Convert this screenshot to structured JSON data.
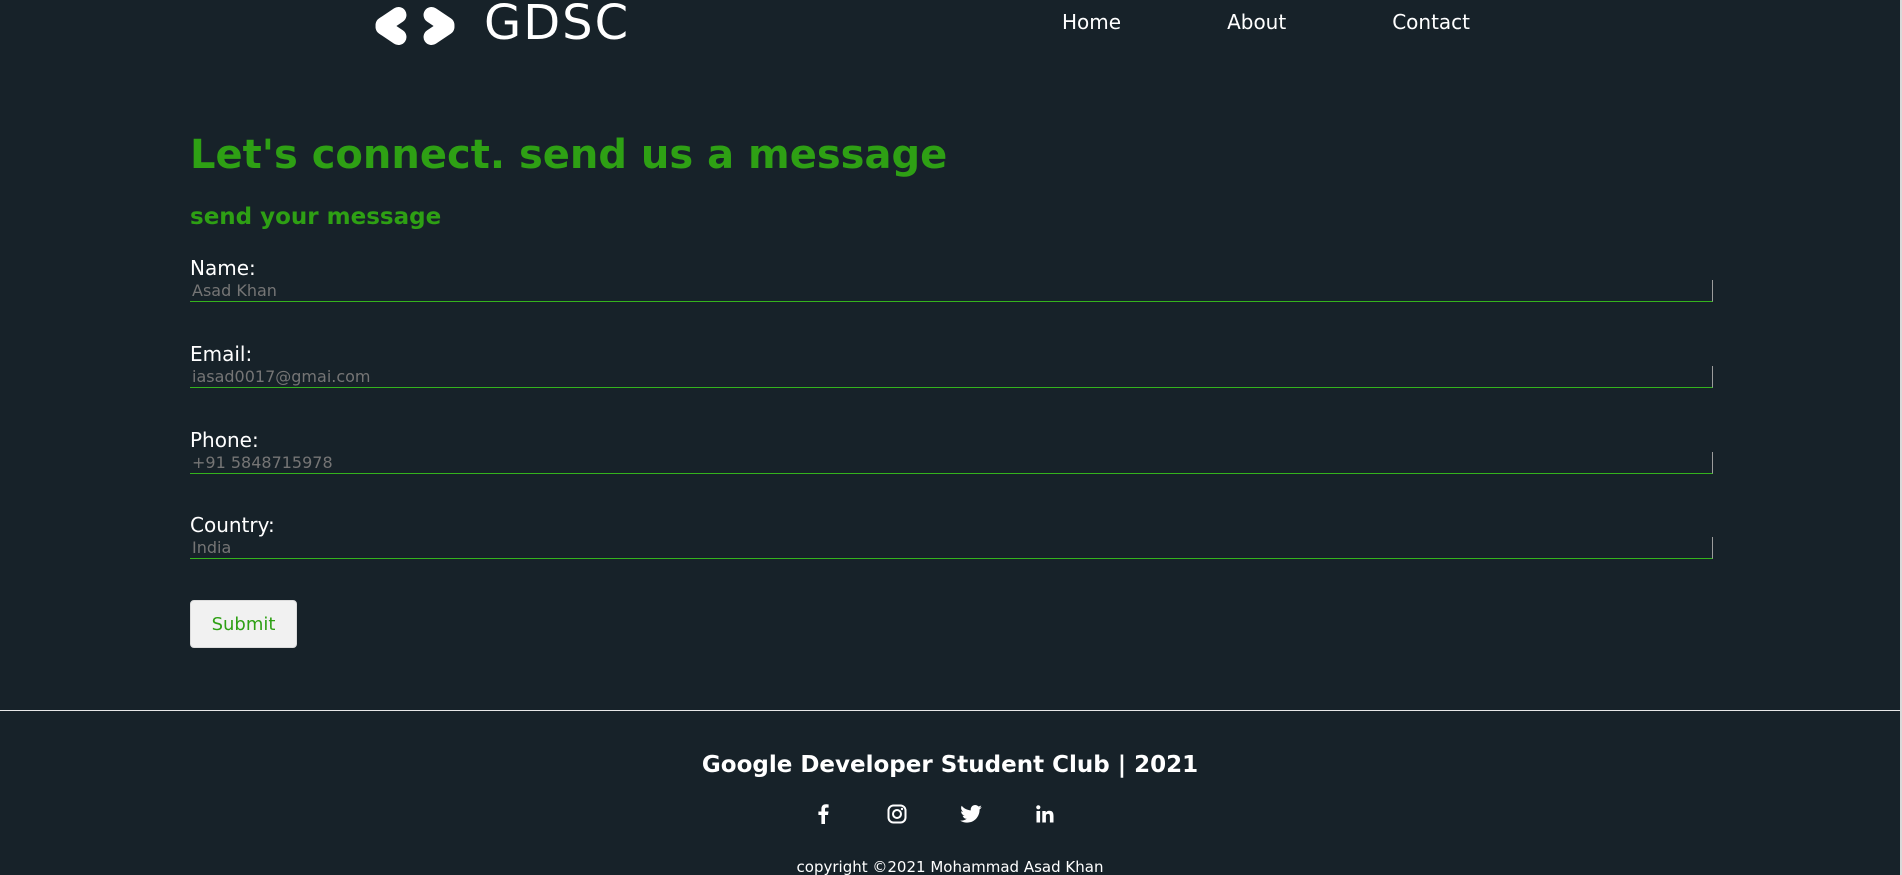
{
  "header": {
    "logo_text": "GDSC",
    "nav": {
      "home": "Home",
      "about": "About",
      "contact": "Contact"
    }
  },
  "contact": {
    "heading": "Let's connect. send us a message",
    "subheading": "send your message",
    "fields": {
      "name": {
        "label": "Name:",
        "placeholder": "Asad Khan"
      },
      "email": {
        "label": "Email:",
        "placeholder": "iasad0017@gmai.com"
      },
      "phone": {
        "label": "Phone:",
        "placeholder": "+91 5848715978"
      },
      "country": {
        "label": "Country:",
        "placeholder": "India"
      }
    },
    "submit_label": "Submit"
  },
  "footer": {
    "title": "Google Developer Student Club | 2021",
    "social": [
      "facebook-icon",
      "instagram-icon",
      "twitter-icon",
      "linkedin-icon"
    ],
    "copyright": "copyright ©2021 Mohammad Asad Khan"
  },
  "colors": {
    "background": "#172229",
    "accent_green": "#2ea014",
    "input_underline": "#34b31d",
    "text": "#ffffff",
    "placeholder": "#9ea5a8",
    "button_bg": "#f1f1f1"
  }
}
